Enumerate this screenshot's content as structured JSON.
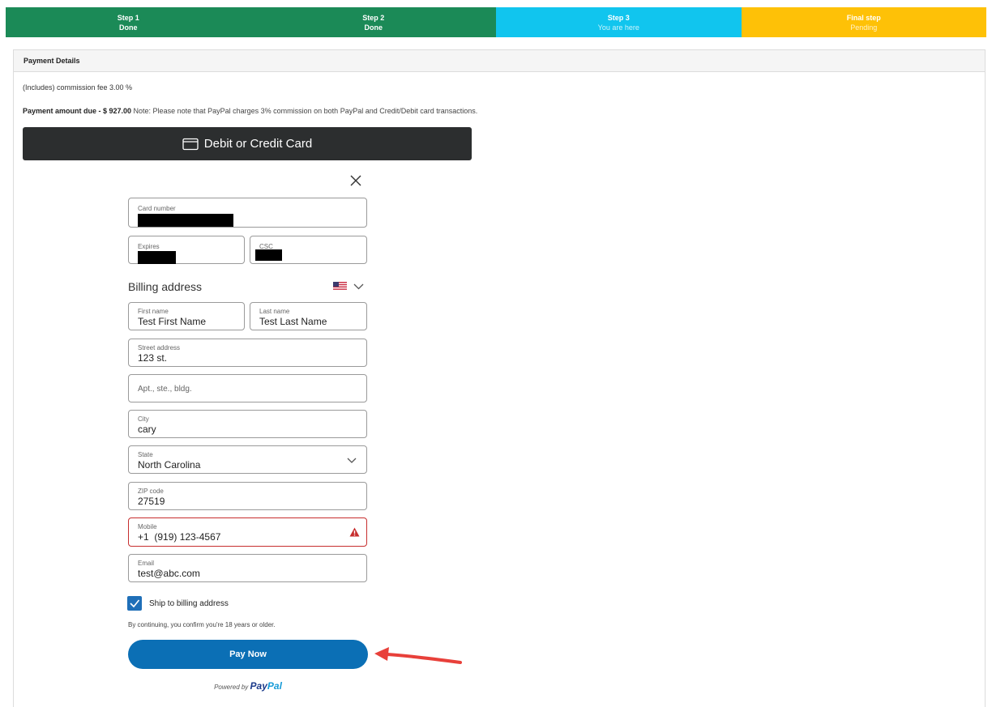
{
  "steps": [
    {
      "title": "Step 1",
      "status": "Done"
    },
    {
      "title": "Step 2",
      "status": "Done"
    },
    {
      "title": "Step 3",
      "status": "You are here"
    },
    {
      "title": "Final step",
      "status": "Pending"
    }
  ],
  "panel": {
    "title": "Payment Details",
    "commission": "(Includes) commission fee 3.00 %",
    "amount_label": "Payment amount due - $ 927.00",
    "amount_note": " Note: Please note that PayPal charges 3% commission on both PayPal and Credit/Debit card transactions."
  },
  "card_button": {
    "label": "Debit or Credit Card"
  },
  "form": {
    "card_number": {
      "label": "Card number"
    },
    "expires": {
      "label": "Expires"
    },
    "csc": {
      "label": "CSC"
    },
    "billing_title": "Billing address",
    "first_name": {
      "label": "First name",
      "value": "Test First Name"
    },
    "last_name": {
      "label": "Last name",
      "value": "Test Last Name"
    },
    "street": {
      "label": "Street address",
      "value": "123 st."
    },
    "apt": {
      "placeholder": "Apt., ste., bldg."
    },
    "city": {
      "label": "City",
      "value": "cary"
    },
    "state": {
      "label": "State",
      "value": "North Carolina"
    },
    "zip": {
      "label": "ZIP code",
      "value": "27519"
    },
    "mobile": {
      "label": "Mobile",
      "value": "+1  (919) 123-4567"
    },
    "email": {
      "label": "Email",
      "value": "test@abc.com"
    },
    "ship_label": "Ship to billing address",
    "ship_checked": true,
    "confirm_text": "By continuing, you confirm you're 18 years or older.",
    "pay_label": "Pay Now",
    "powered_by": "Powered by",
    "brand_pay": "Pay",
    "brand_pal": "Pal"
  },
  "colors": {
    "step_done": "#1b8a57",
    "step_here": "#11c5ee",
    "step_pending": "#fec107",
    "pay_button": "#0b6fb5",
    "error": "#c72e2e",
    "arrow": "#e8403a"
  },
  "icons": [
    "card-icon",
    "close-icon",
    "us-flag-icon",
    "chevron-down-icon",
    "warning-icon",
    "checkmark-icon",
    "red-arrow-annotation"
  ]
}
